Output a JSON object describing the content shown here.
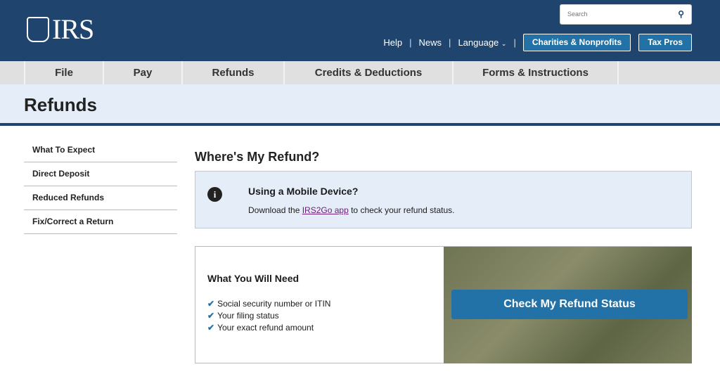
{
  "header": {
    "logo_text": "IRS",
    "search_placeholder": "Search",
    "util_links": [
      "Help",
      "News",
      "Language"
    ],
    "buttons": [
      "Charities & Nonprofits",
      "Tax Pros"
    ]
  },
  "nav": [
    "File",
    "Pay",
    "Refunds",
    "Credits & Deductions",
    "Forms & Instructions"
  ],
  "page_title": "Refunds",
  "sidebar": [
    "What To Expect",
    "Direct Deposit",
    "Reduced Refunds",
    "Fix/Correct a Return"
  ],
  "main": {
    "title": "Where's My Refund?",
    "alert": {
      "title": "Using a Mobile Device?",
      "text_before": "Download the ",
      "link": "IRS2Go app",
      "text_after": " to check your refund status."
    },
    "need": {
      "title": "What You Will Need",
      "items": [
        "Social security number or ITIN",
        "Your filing status",
        "Your exact refund amount"
      ]
    },
    "cta": "Check My Refund Status"
  }
}
